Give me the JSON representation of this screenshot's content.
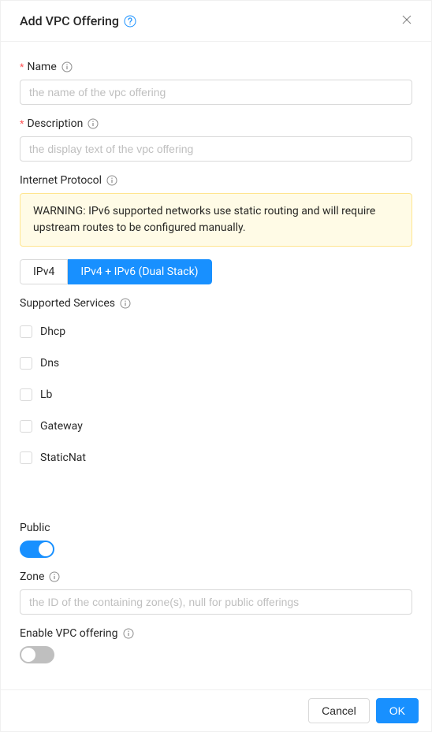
{
  "header": {
    "title": "Add VPC Offering",
    "close_label": "×"
  },
  "fields": {
    "name": {
      "label": "Name",
      "required": "*",
      "placeholder": "the name of the vpc offering"
    },
    "description": {
      "label": "Description",
      "required": "*",
      "placeholder": "the display text of the vpc offering"
    },
    "internet_protocol": {
      "label": "Internet Protocol",
      "warning": "WARNING: IPv6 supported networks use static routing and will require upstream routes to be configured manually.",
      "options": [
        {
          "label": "IPv4",
          "selected": false
        },
        {
          "label": "IPv4 + IPv6 (Dual Stack)",
          "selected": true
        }
      ]
    },
    "supported_services": {
      "label": "Supported Services",
      "items": [
        {
          "label": "Dhcp"
        },
        {
          "label": "Dns"
        },
        {
          "label": "Lb"
        },
        {
          "label": "Gateway"
        },
        {
          "label": "StaticNat"
        }
      ]
    },
    "public": {
      "label": "Public",
      "enabled": true
    },
    "zone": {
      "label": "Zone",
      "placeholder": "the ID of the containing zone(s), null for public offerings"
    },
    "enable_offering": {
      "label": "Enable VPC offering",
      "enabled": false
    }
  },
  "footer": {
    "cancel": "Cancel",
    "ok": "OK"
  },
  "colors": {
    "primary": "#1890ff",
    "warning_bg": "#fffbe6",
    "warning_border": "#ffe58f"
  }
}
